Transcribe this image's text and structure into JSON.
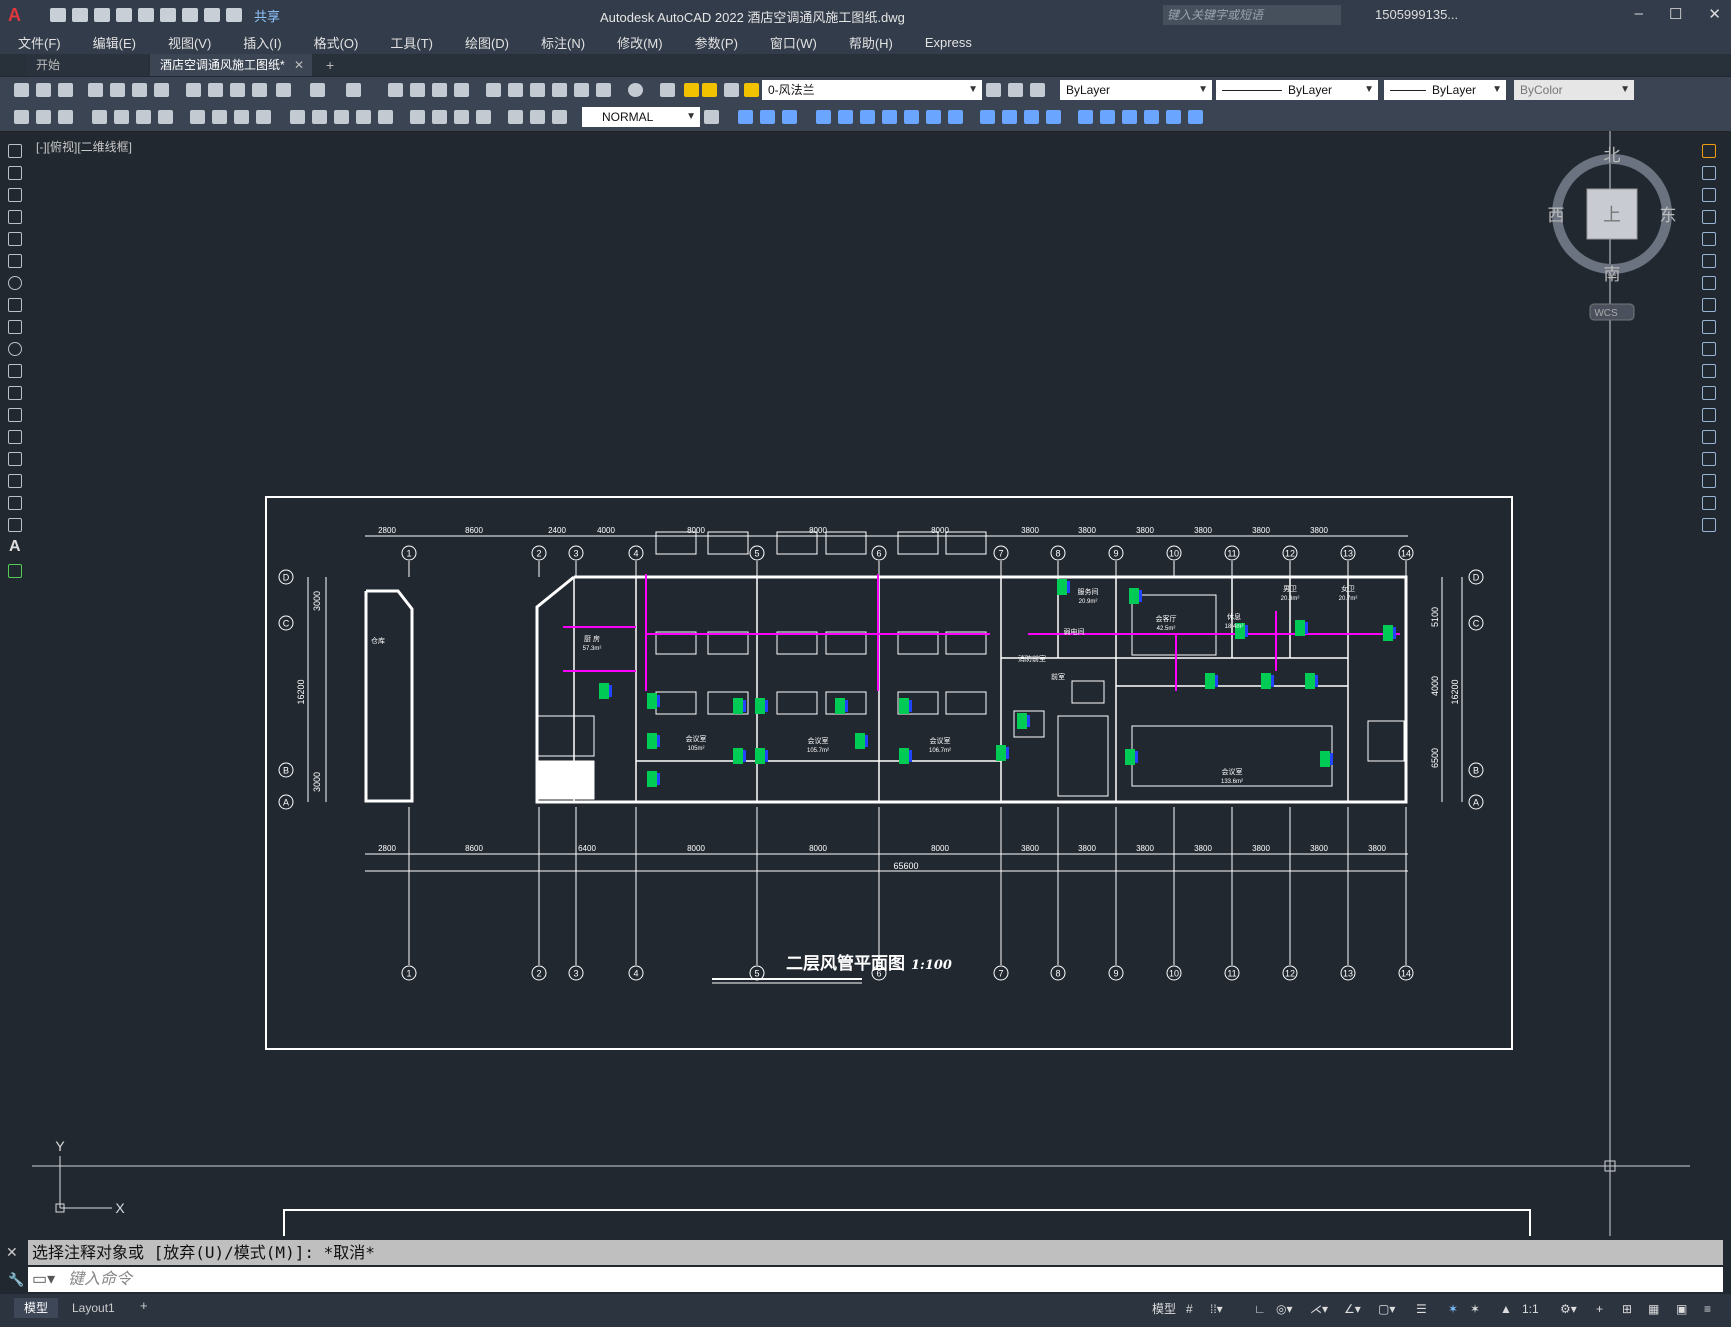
{
  "app": {
    "logo": "A",
    "title": "Autodesk AutoCAD 2022    酒店空调通风施工图纸.dwg",
    "share": "共享",
    "search_placeholder": "键入关键字或短语",
    "user": "1505999135...",
    "help": "?"
  },
  "menu": [
    "文件(F)",
    "编辑(E)",
    "视图(V)",
    "插入(I)",
    "格式(O)",
    "工具(T)",
    "绘图(D)",
    "标注(N)",
    "修改(M)",
    "参数(P)",
    "窗口(W)",
    "帮助(H)",
    "Express"
  ],
  "tabs": {
    "start": "开始",
    "active": "酒店空调通风施工图纸*",
    "add": "+"
  },
  "toolbar": {
    "layer": "0-风法兰",
    "color": "ByLayer",
    "linetype": "ByLayer",
    "lineweight": "ByLayer",
    "plotstyle": "ByColor",
    "dimstyle": "NORMAL"
  },
  "viewport_label": "[-][俯视][二维线框]",
  "viewcube": {
    "north": "北",
    "south": "南",
    "east": "东",
    "west": "西",
    "face": "上",
    "wcs": "WCS"
  },
  "ucs": {
    "x": "X",
    "y": "Y"
  },
  "drawing": {
    "title": "二层风管平面图",
    "scale": "1:100",
    "grid_top": [
      "1",
      "2",
      "3",
      "4",
      "5",
      "6",
      "7",
      "8",
      "9",
      "10",
      "11",
      "12",
      "13",
      "14"
    ],
    "grid_side": [
      "D",
      "C",
      "B",
      "A"
    ],
    "dims_top": [
      "2800",
      "8600",
      "2400",
      "4000",
      "8000",
      "8000",
      "8000",
      "3800",
      "3800",
      "3800",
      "3800",
      "3800",
      "3800"
    ],
    "dims_bottom": [
      "2800",
      "8600",
      "6400",
      "8000",
      "8000",
      "8000",
      "3800",
      "3800",
      "3800",
      "3800",
      "3800",
      "3800",
      "3800"
    ],
    "total": "65600",
    "left_dims": [
      "3000",
      "16200",
      "3000"
    ],
    "right_dims": [
      "5100",
      "4000",
      "6500",
      "16200"
    ],
    "rooms": [
      {
        "name": "仓库"
      },
      {
        "name": "厨 房",
        "area": "57.3m²"
      },
      {
        "name": "会议室",
        "area": "105m²"
      },
      {
        "name": "会议室",
        "area": "105.7m²"
      },
      {
        "name": "会议室",
        "area": "106.7m²"
      },
      {
        "name": "会议室",
        "area": "133.6m²"
      },
      {
        "name": "会客厅",
        "area": "42.5m²"
      },
      {
        "name": "休息",
        "area": "18.4m²"
      },
      {
        "name": "男卫",
        "area": "20.3m²"
      },
      {
        "name": "女卫",
        "area": "20.7m²"
      },
      {
        "name": "服务间",
        "area": "20.9m²"
      },
      {
        "name": "弱电间"
      },
      {
        "name": "前室"
      },
      {
        "name": "消防前室"
      }
    ]
  },
  "command": {
    "history": "选择注释对象或 [放弃(U)/模式(M)]: *取消*",
    "placeholder": "键入命令"
  },
  "status": {
    "model_tab": "模型",
    "layout_tab": "Layout1",
    "add": "+",
    "model_btn": "模型",
    "scale": "1:1"
  },
  "colors": {
    "canvas": "#212830",
    "line": "#ffffff",
    "duct": "#ff00ff",
    "unit": "#00ff66",
    "unit_blue": "#2244ff"
  }
}
